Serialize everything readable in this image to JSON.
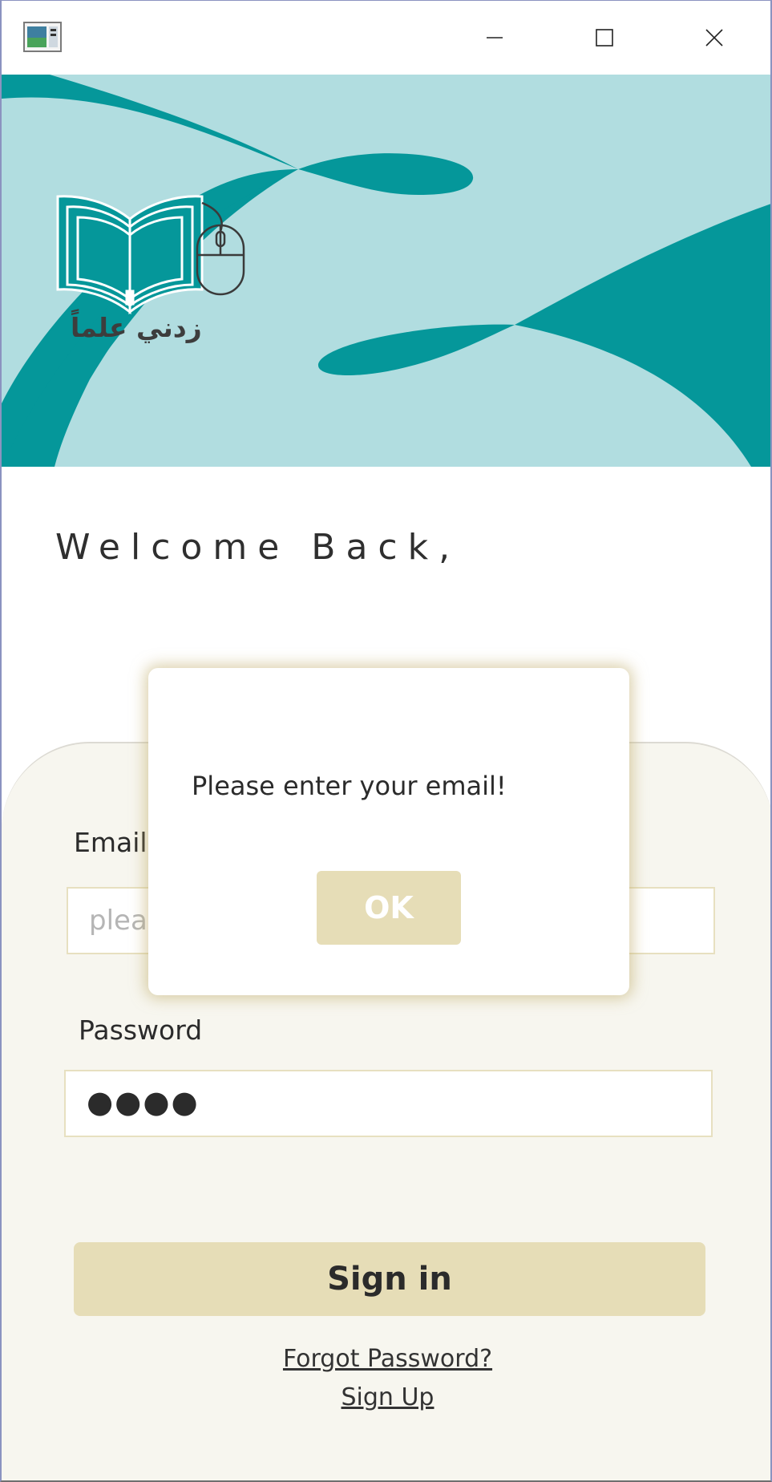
{
  "window": {
    "controls": {
      "minimize_icon": "minimize-icon",
      "maximize_icon": "maximize-icon",
      "close_icon": "close-icon"
    }
  },
  "banner": {
    "logo_text": "زدني علماً",
    "colors": {
      "light": "#b1dde0",
      "dark": "#05979a"
    }
  },
  "welcome": {
    "text": "Welcome Back,"
  },
  "form": {
    "email_label": "Email",
    "email_placeholder": "please enter your email",
    "password_label": "Password",
    "password_value": "●●●●",
    "signin_label": "Sign in",
    "forgot_link": "Forgot Password?",
    "signup_link": "Sign Up"
  },
  "dialog": {
    "message": "Please enter your email!",
    "ok_label": "OK"
  },
  "colors": {
    "accent": "#e6ddb7",
    "card_bg": "#f7f6ef"
  }
}
